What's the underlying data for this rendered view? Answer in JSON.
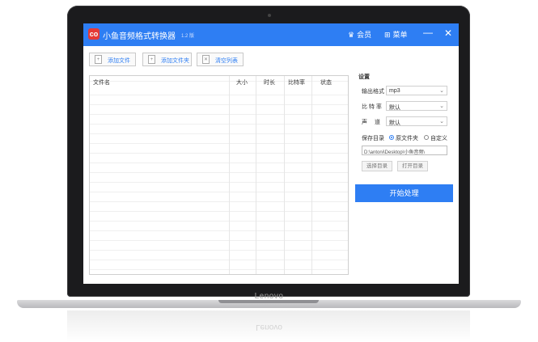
{
  "device": {
    "brand": "Lenovo"
  },
  "app": {
    "title": "小鱼音频格式转换器",
    "version": "1.2 版",
    "logo_text": "co",
    "colors": {
      "accent": "#2e7ef3",
      "logo": "#e53935"
    }
  },
  "titlebar": {
    "member_label": "会员",
    "member_icon": "crown-icon",
    "menu_label": "菜单",
    "menu_icon": "grid-icon",
    "minimize": "—",
    "close": "✕"
  },
  "toolbar": {
    "add_file": "添加文件",
    "add_folder": "添加文件夹",
    "clear_list": "清空列表"
  },
  "filelist": {
    "columns": [
      "文件名",
      "大小",
      "时长",
      "比特率",
      "状态"
    ],
    "rows": []
  },
  "settings": {
    "title": "设置",
    "output_format_label": "输出格式",
    "output_format_value": "mp3",
    "bitrate_label": "比 特 率",
    "bitrate_value": "默认",
    "channel_label": "声　 道",
    "channel_value": "默认",
    "save_dir_label": "保存目录",
    "option_original": "原文件夹",
    "option_custom": "自定义",
    "selected_option": "原文件夹",
    "path_value": "D:\\antoni\\Desktop\\小鱼音频\\",
    "choose_dir": "选择目录",
    "open_dir": "打开目录",
    "start": "开始处理"
  }
}
